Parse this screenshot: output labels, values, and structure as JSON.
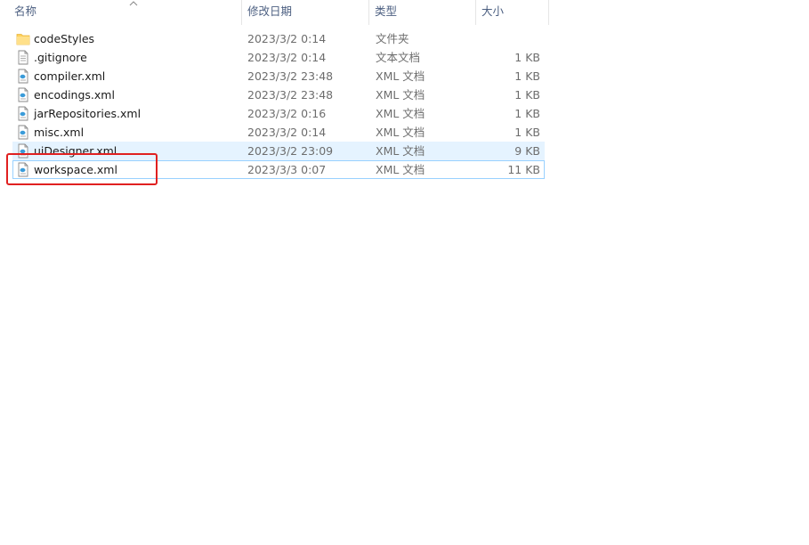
{
  "columns": {
    "name": "名称",
    "date": "修改日期",
    "type": "类型",
    "size": "大小"
  },
  "sort": {
    "column": "name",
    "direction": "ascending"
  },
  "files": [
    {
      "name": "codeStyles",
      "date": "2023/3/2 0:14",
      "type": "文件夹",
      "size": "",
      "icon": "folder-icon"
    },
    {
      "name": ".gitignore",
      "date": "2023/3/2 0:14",
      "type": "文本文档",
      "size": "1 KB",
      "icon": "text-file-icon"
    },
    {
      "name": "compiler.xml",
      "date": "2023/3/2 23:48",
      "type": "XML 文档",
      "size": "1 KB",
      "icon": "xml-file-icon"
    },
    {
      "name": "encodings.xml",
      "date": "2023/3/2 23:48",
      "type": "XML 文档",
      "size": "1 KB",
      "icon": "xml-file-icon"
    },
    {
      "name": "jarRepositories.xml",
      "date": "2023/3/2 0:16",
      "type": "XML 文档",
      "size": "1 KB",
      "icon": "xml-file-icon"
    },
    {
      "name": "misc.xml",
      "date": "2023/3/2 0:14",
      "type": "XML 文档",
      "size": "1 KB",
      "icon": "xml-file-icon"
    },
    {
      "name": "uiDesigner.xml",
      "date": "2023/3/2 23:09",
      "type": "XML 文档",
      "size": "9 KB",
      "icon": "xml-file-icon"
    },
    {
      "name": "workspace.xml",
      "date": "2023/3/3 0:07",
      "type": "XML 文档",
      "size": "11 KB",
      "icon": "xml-file-icon"
    }
  ],
  "states": {
    "hovered_row": "uiDesigner.xml",
    "selected_row": "workspace.xml",
    "highlighted_row": "workspace.xml"
  },
  "colors": {
    "header_text": "#4d6082",
    "hover_bg": "#e5f3ff",
    "selected_border": "#99d1ff",
    "highlight_box": "#e02020",
    "folder": "#ffd15c"
  }
}
